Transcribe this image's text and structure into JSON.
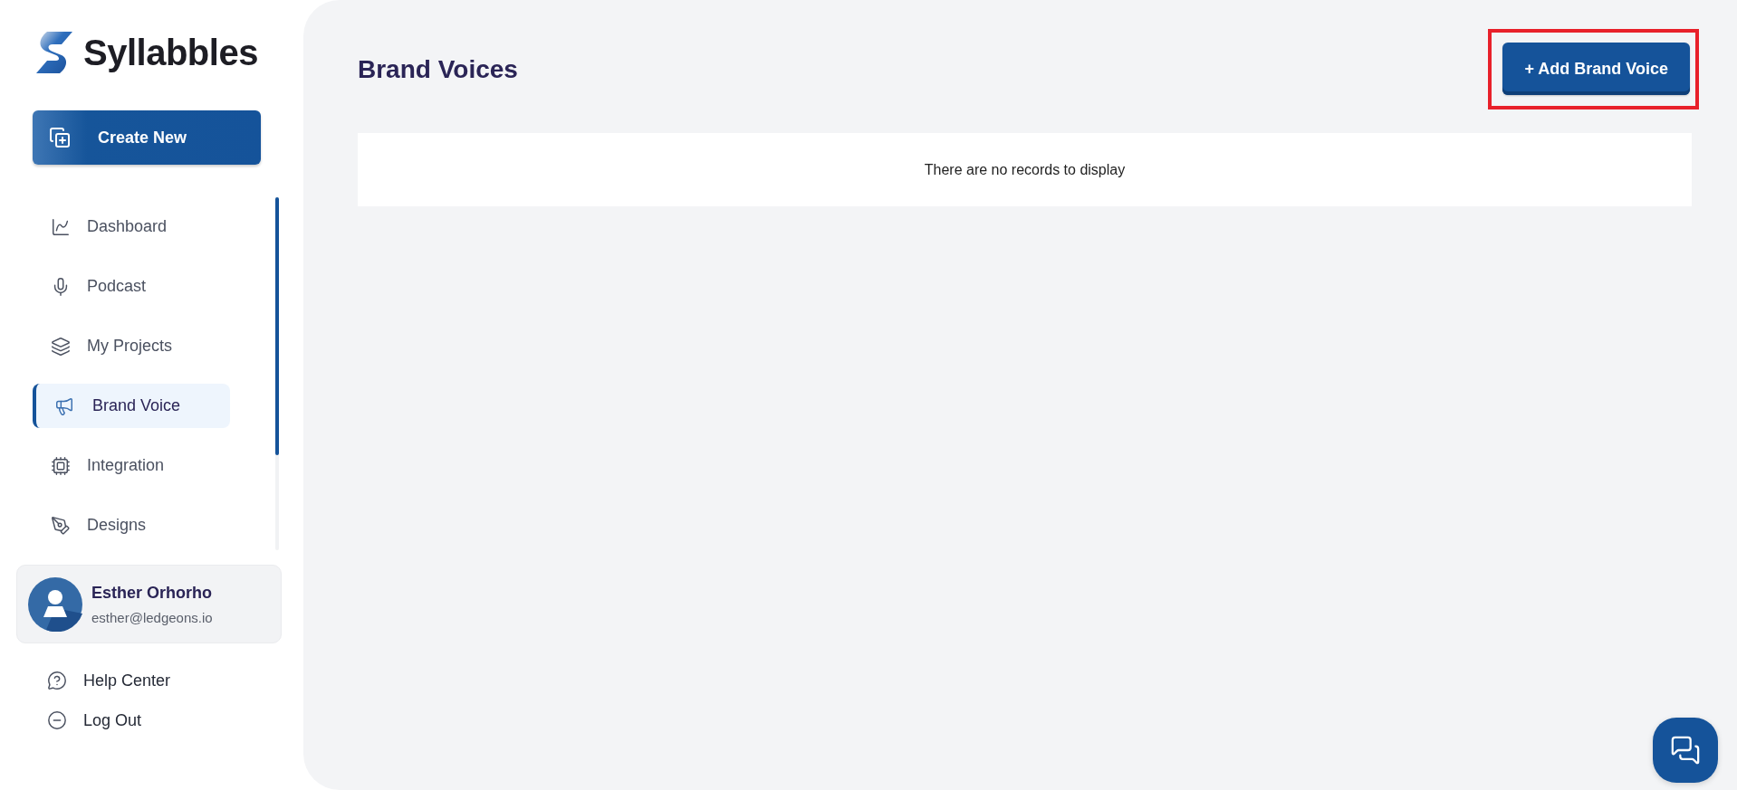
{
  "brand": {
    "name": "Syllabbles"
  },
  "create_button": {
    "label": "Create New"
  },
  "nav": [
    {
      "kind": "dashboard",
      "label": "Dashboard",
      "selected": false
    },
    {
      "kind": "podcast",
      "label": "Podcast",
      "selected": false
    },
    {
      "kind": "projects",
      "label": "My Projects",
      "selected": false
    },
    {
      "kind": "brand",
      "label": "Brand Voice",
      "selected": true
    },
    {
      "kind": "integration",
      "label": "Integration",
      "selected": false
    },
    {
      "kind": "designs",
      "label": "Designs",
      "selected": false
    }
  ],
  "user": {
    "name": "Esther Orhorho",
    "email": "esther@ledgeons.io"
  },
  "footer_links": [
    {
      "kind": "help",
      "label": "Help Center"
    },
    {
      "kind": "logout",
      "label": "Log Out"
    }
  ],
  "main": {
    "title": "Brand Voices",
    "add_button": {
      "label": "+ Add Brand Voice",
      "highlighted": true
    },
    "empty_message": "There are no records to display"
  }
}
